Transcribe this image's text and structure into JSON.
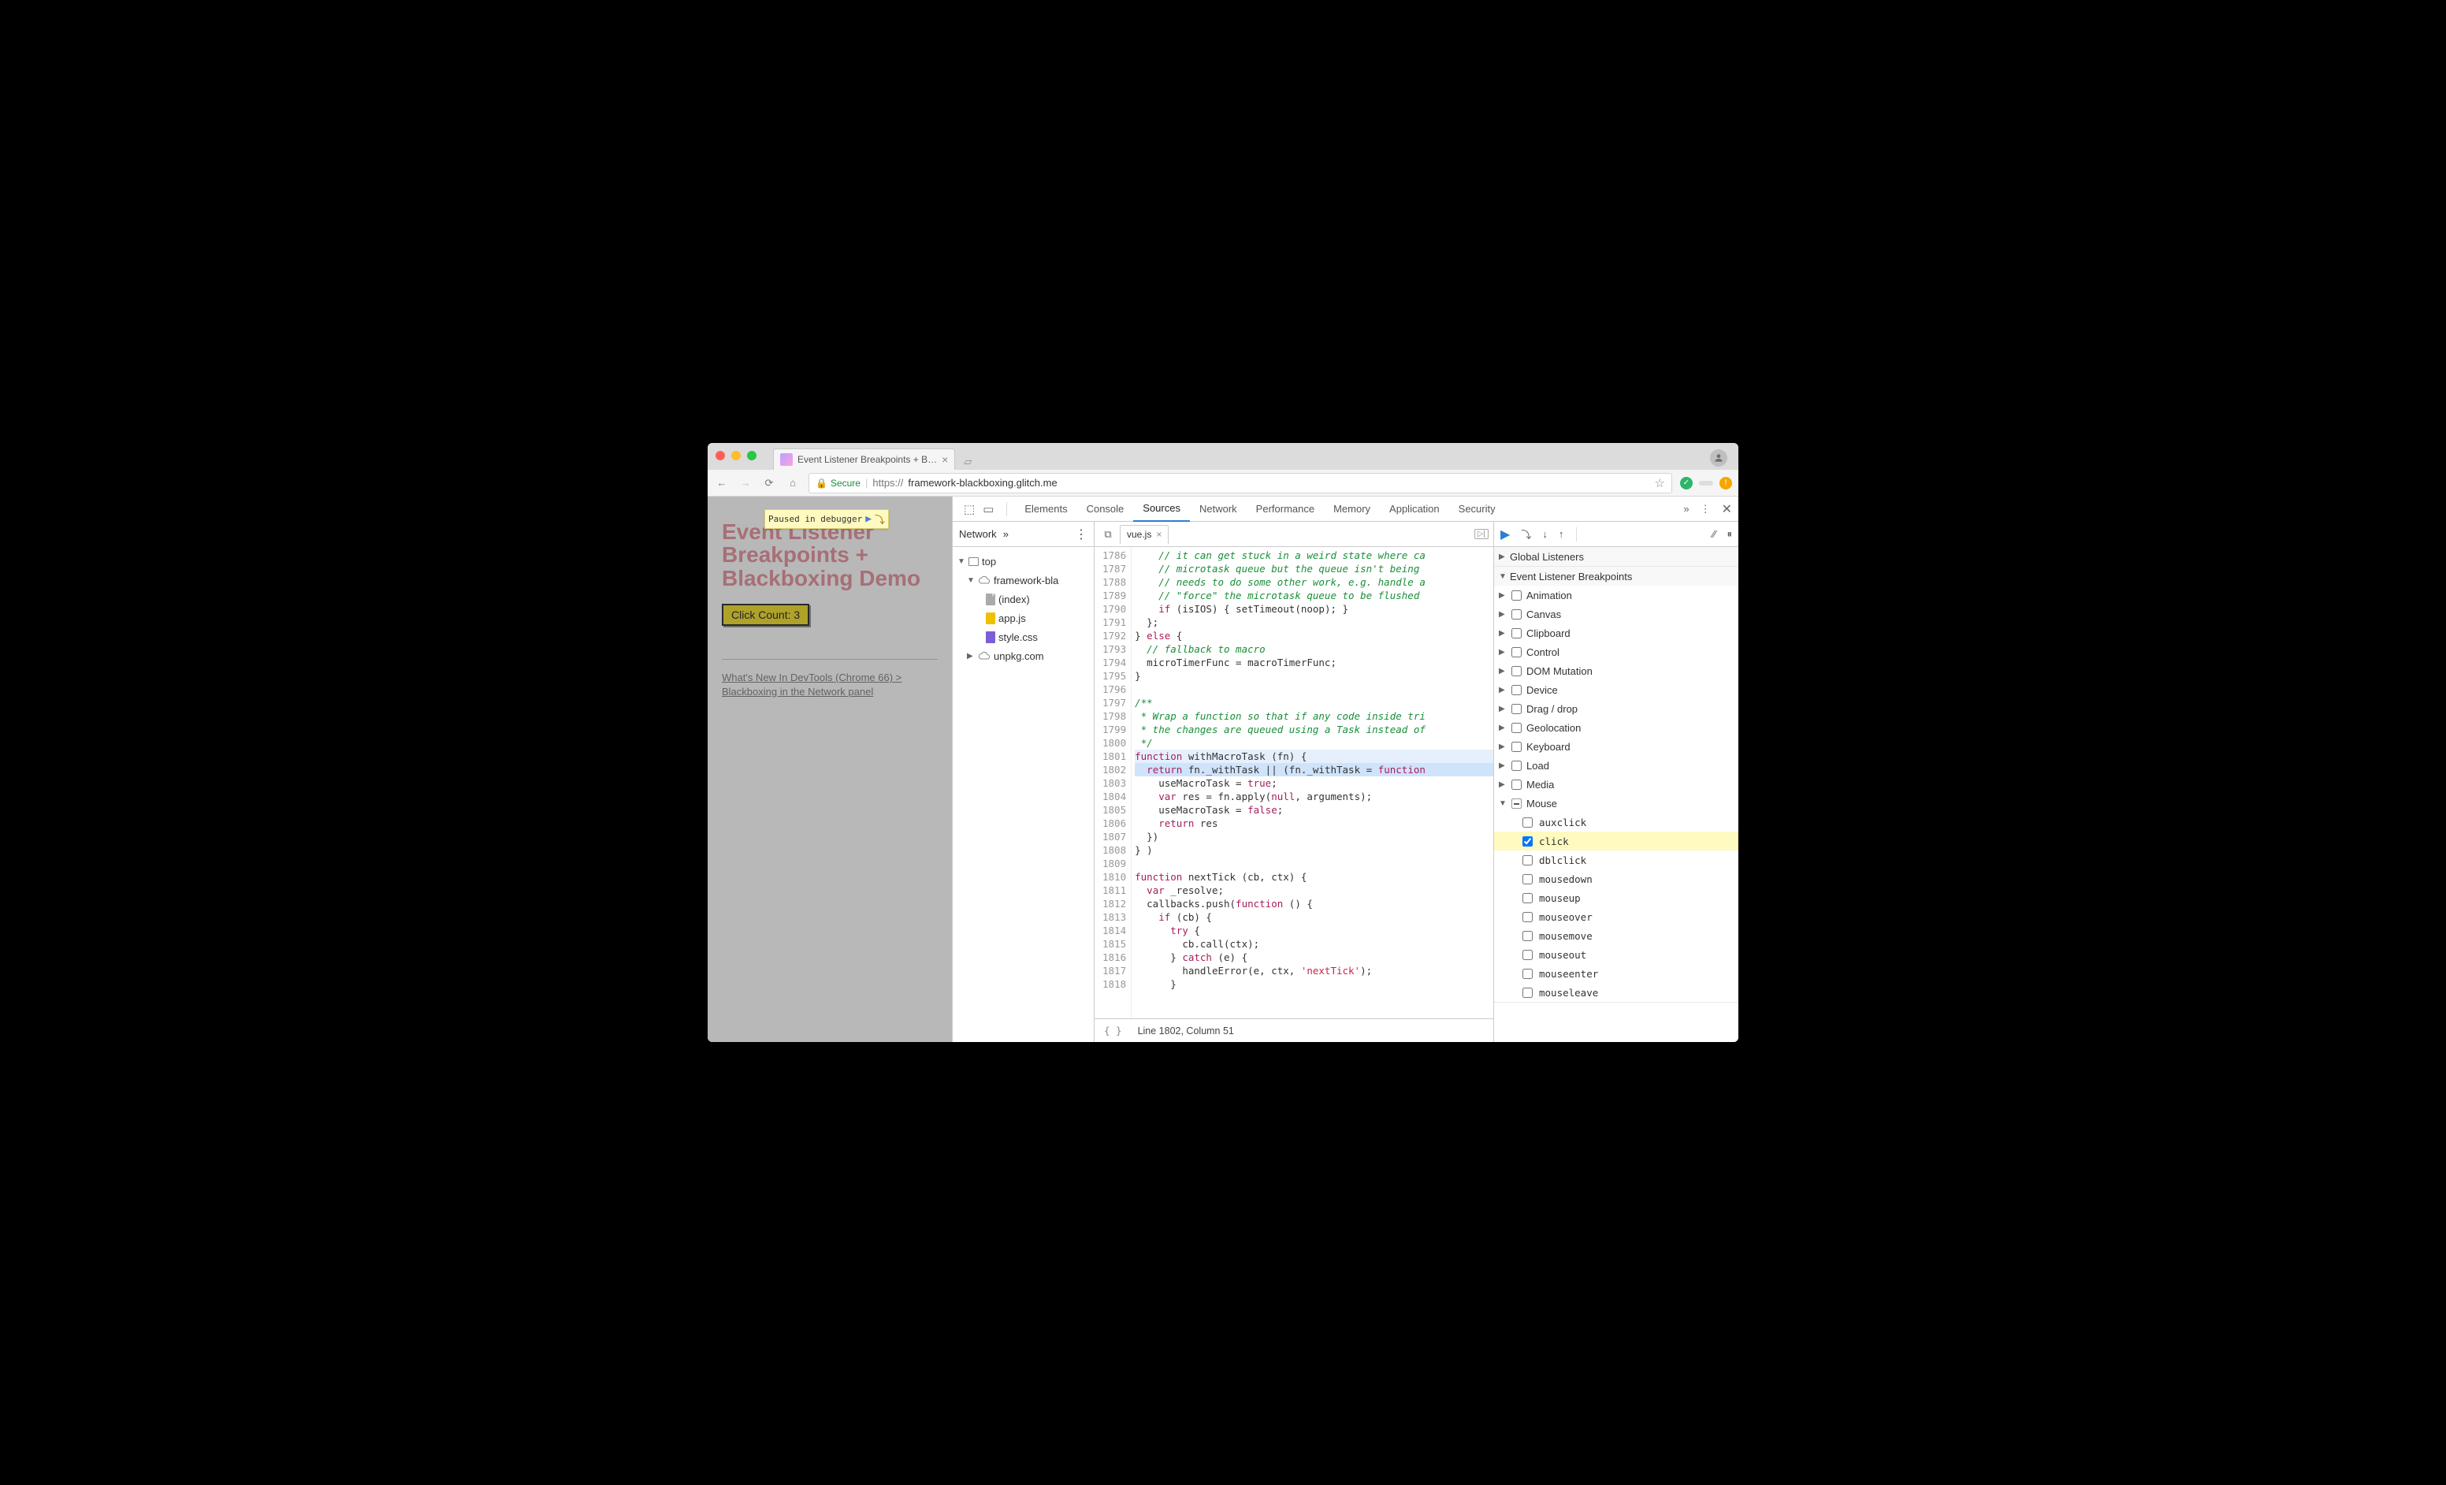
{
  "browser": {
    "tab_title": "Event Listener Breakpoints + B…",
    "secure_label": "Secure",
    "url_prefix": "https://",
    "url_display": "framework-blackboxing.glitch.me"
  },
  "page": {
    "paused_label": "Paused in debugger",
    "title_l1": "Event Listener",
    "title_l2": "Breakpoints +",
    "title_l3": "Blackboxing Demo",
    "click_button": "Click Count: 3",
    "link_l1": "What's New In DevTools (Chrome 66) >",
    "link_l2": "Blackboxing in the Network panel"
  },
  "devtools": {
    "panels": [
      "Elements",
      "Console",
      "Sources",
      "Network",
      "Performance",
      "Memory",
      "Application",
      "Security"
    ],
    "active_panel": "Sources",
    "nav_tab": "Network",
    "tree": {
      "top": "top",
      "domain": "framework-bla",
      "files": [
        "(index)",
        "app.js",
        "style.css"
      ],
      "cdn": "unpkg.com"
    },
    "editor": {
      "tab": "vue.js",
      "first_line": 1786,
      "highlight_exec": 1801,
      "highlight_pause": 1802,
      "lines": [
        "    // it can get stuck in a weird state where ca",
        "    // microtask queue but the queue isn't being ",
        "    // needs to do some other work, e.g. handle a",
        "    // \"force\" the microtask queue to be flushed ",
        "    if (isIOS) { setTimeout(noop); }",
        "  };",
        "} else {",
        "  // fallback to macro",
        "  microTimerFunc = macroTimerFunc;",
        "}",
        "",
        "/**",
        " * Wrap a function so that if any code inside tri",
        " * the changes are queued using a Task instead of",
        " */",
        "function withMacroTask (fn) {",
        "  return fn._withTask || (fn._withTask = function",
        "    useMacroTask = true;",
        "    var res = fn.apply(null, arguments);",
        "    useMacroTask = false;",
        "    return res",
        "  })",
        "} )",
        "",
        "function nextTick (cb, ctx) {",
        "  var _resolve;",
        "  callbacks.push(function () {",
        "    if (cb) {",
        "      try {",
        "        cb.call(ctx);",
        "      } catch (e) {",
        "        handleError(e, ctx, 'nextTick');",
        "      }"
      ],
      "status": "Line 1802, Column 51"
    },
    "debugger": {
      "global_listeners": "Global Listeners",
      "breakpoints_title": "Event Listener Breakpoints",
      "categories": [
        "Animation",
        "Canvas",
        "Clipboard",
        "Control",
        "DOM Mutation",
        "Device",
        "Drag / drop",
        "Geolocation",
        "Keyboard",
        "Load",
        "Media"
      ],
      "mouse": {
        "label": "Mouse",
        "events": [
          "auxclick",
          "click",
          "dblclick",
          "mousedown",
          "mouseup",
          "mouseover",
          "mousemove",
          "mouseout",
          "mouseenter",
          "mouseleave"
        ],
        "checked": "click"
      }
    }
  }
}
